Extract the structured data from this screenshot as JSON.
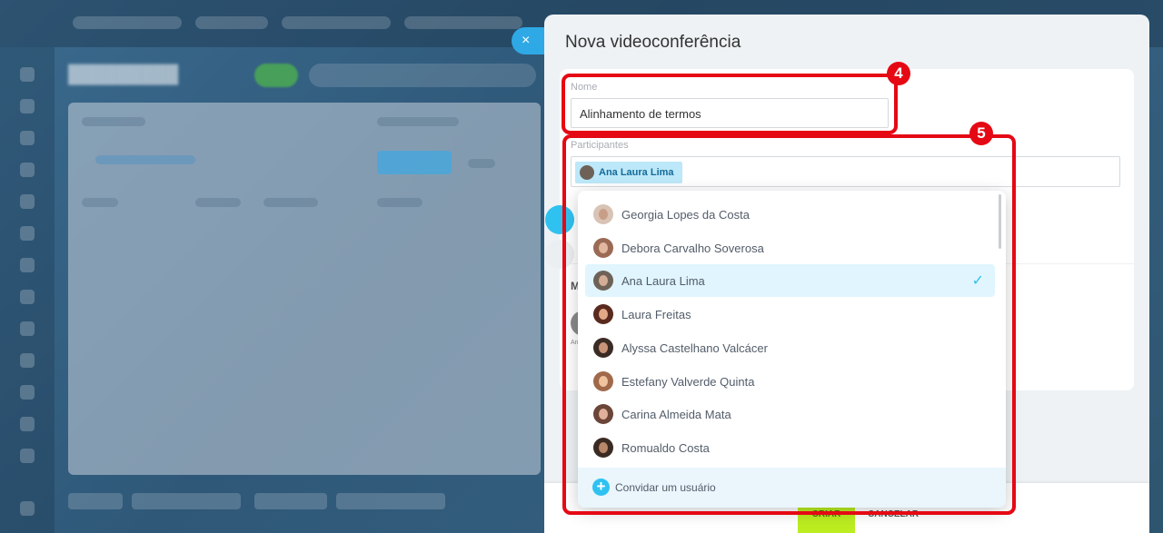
{
  "dialog": {
    "title": "Nova videoconferência",
    "close_icon": "×",
    "name_field": {
      "label": "Nome",
      "value": "Alinhamento de termos"
    },
    "participants_field": {
      "label": "Participantes",
      "selected_chip": "Ana Laura Lima"
    }
  },
  "participants_list": [
    {
      "name": "Georgia Lopes da Costa",
      "selected": false,
      "avatar_color": "#d9c3b5",
      "face_color": "#c79e88"
    },
    {
      "name": "Debora Carvalho Soverosa",
      "selected": false,
      "avatar_color": "#9b6a55",
      "face_color": "#e2b79f"
    },
    {
      "name": "Ana Laura Lima",
      "selected": true,
      "avatar_color": "#6e6258",
      "face_color": "#d3ad96"
    },
    {
      "name": "Laura Freitas",
      "selected": false,
      "avatar_color": "#5a2a1e",
      "face_color": "#e3a887"
    },
    {
      "name": "Alyssa Castelhano Valcácer",
      "selected": false,
      "avatar_color": "#3b2b25",
      "face_color": "#c99478"
    },
    {
      "name": "Estefany Valverde Quinta",
      "selected": false,
      "avatar_color": "#a06a4a",
      "face_color": "#f0c39f"
    },
    {
      "name": "Carina Almeida Mata",
      "selected": false,
      "avatar_color": "#6b4538",
      "face_color": "#e0b09a"
    },
    {
      "name": "Romualdo Costa",
      "selected": false,
      "avatar_color": "#3a2a22",
      "face_color": "#b98769"
    }
  ],
  "invite": {
    "label": "Convidar um usuário",
    "icon": "+"
  },
  "footer": {
    "create_label": "CRIAR",
    "cancel_label": "CANCELAR"
  },
  "annotations": {
    "badge_4": "4",
    "badge_5": "5"
  },
  "colors": {
    "accent": "#2fc2f1",
    "highlight": "#e50914",
    "selected_row": "#e0f5fd",
    "chip_bg": "#bce8f9"
  }
}
